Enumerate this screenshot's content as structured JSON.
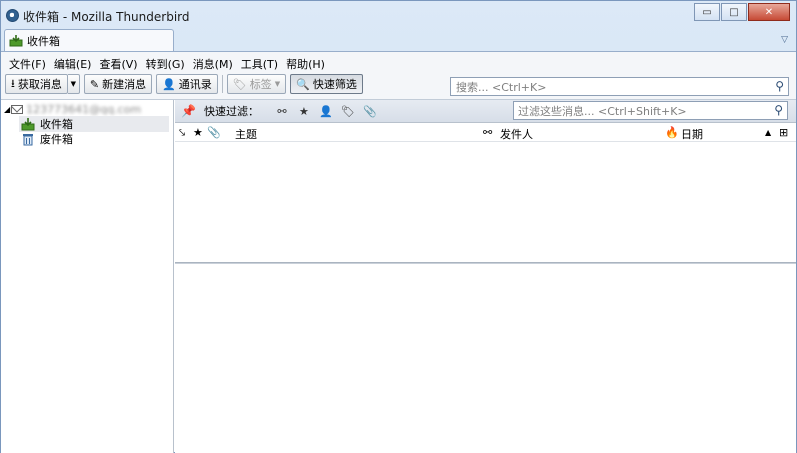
{
  "window": {
    "title": "收件箱 - Mozilla Thunderbird",
    "controls": {
      "minimize": "▭",
      "maximize": "□",
      "close": "✕"
    }
  },
  "tabs": [
    {
      "label": "收件箱",
      "icon": "inbox-icon"
    }
  ],
  "menubar": [
    "文件(F)",
    "编辑(E)",
    "查看(V)",
    "转到(G)",
    "消息(M)",
    "工具(T)",
    "帮助(H)"
  ],
  "toolbar": {
    "get_messages": "获取消息",
    "write": "新建消息",
    "address_book": "通讯录",
    "tag": "标签",
    "quick_filter": "快速筛选"
  },
  "global_search": {
    "placeholder": "搜索... <Ctrl+K>"
  },
  "folder_pane": {
    "account": "123773641@qq.com",
    "folders": [
      {
        "label": "收件箱",
        "icon": "inbox-icon",
        "selected": true
      },
      {
        "label": "废件箱",
        "icon": "trash-icon",
        "selected": false
      }
    ]
  },
  "quick_filter_bar": {
    "label": "快速过滤：",
    "filter_placeholder": "过滤这些消息... <Ctrl+Shift+K>"
  },
  "columns": {
    "subject": "主题",
    "sender": "发件人",
    "date": "日期"
  },
  "colors": {
    "window_frame": "#c7dbf1",
    "chrome": "#f4f6f9",
    "selection": "#e8eaee"
  }
}
